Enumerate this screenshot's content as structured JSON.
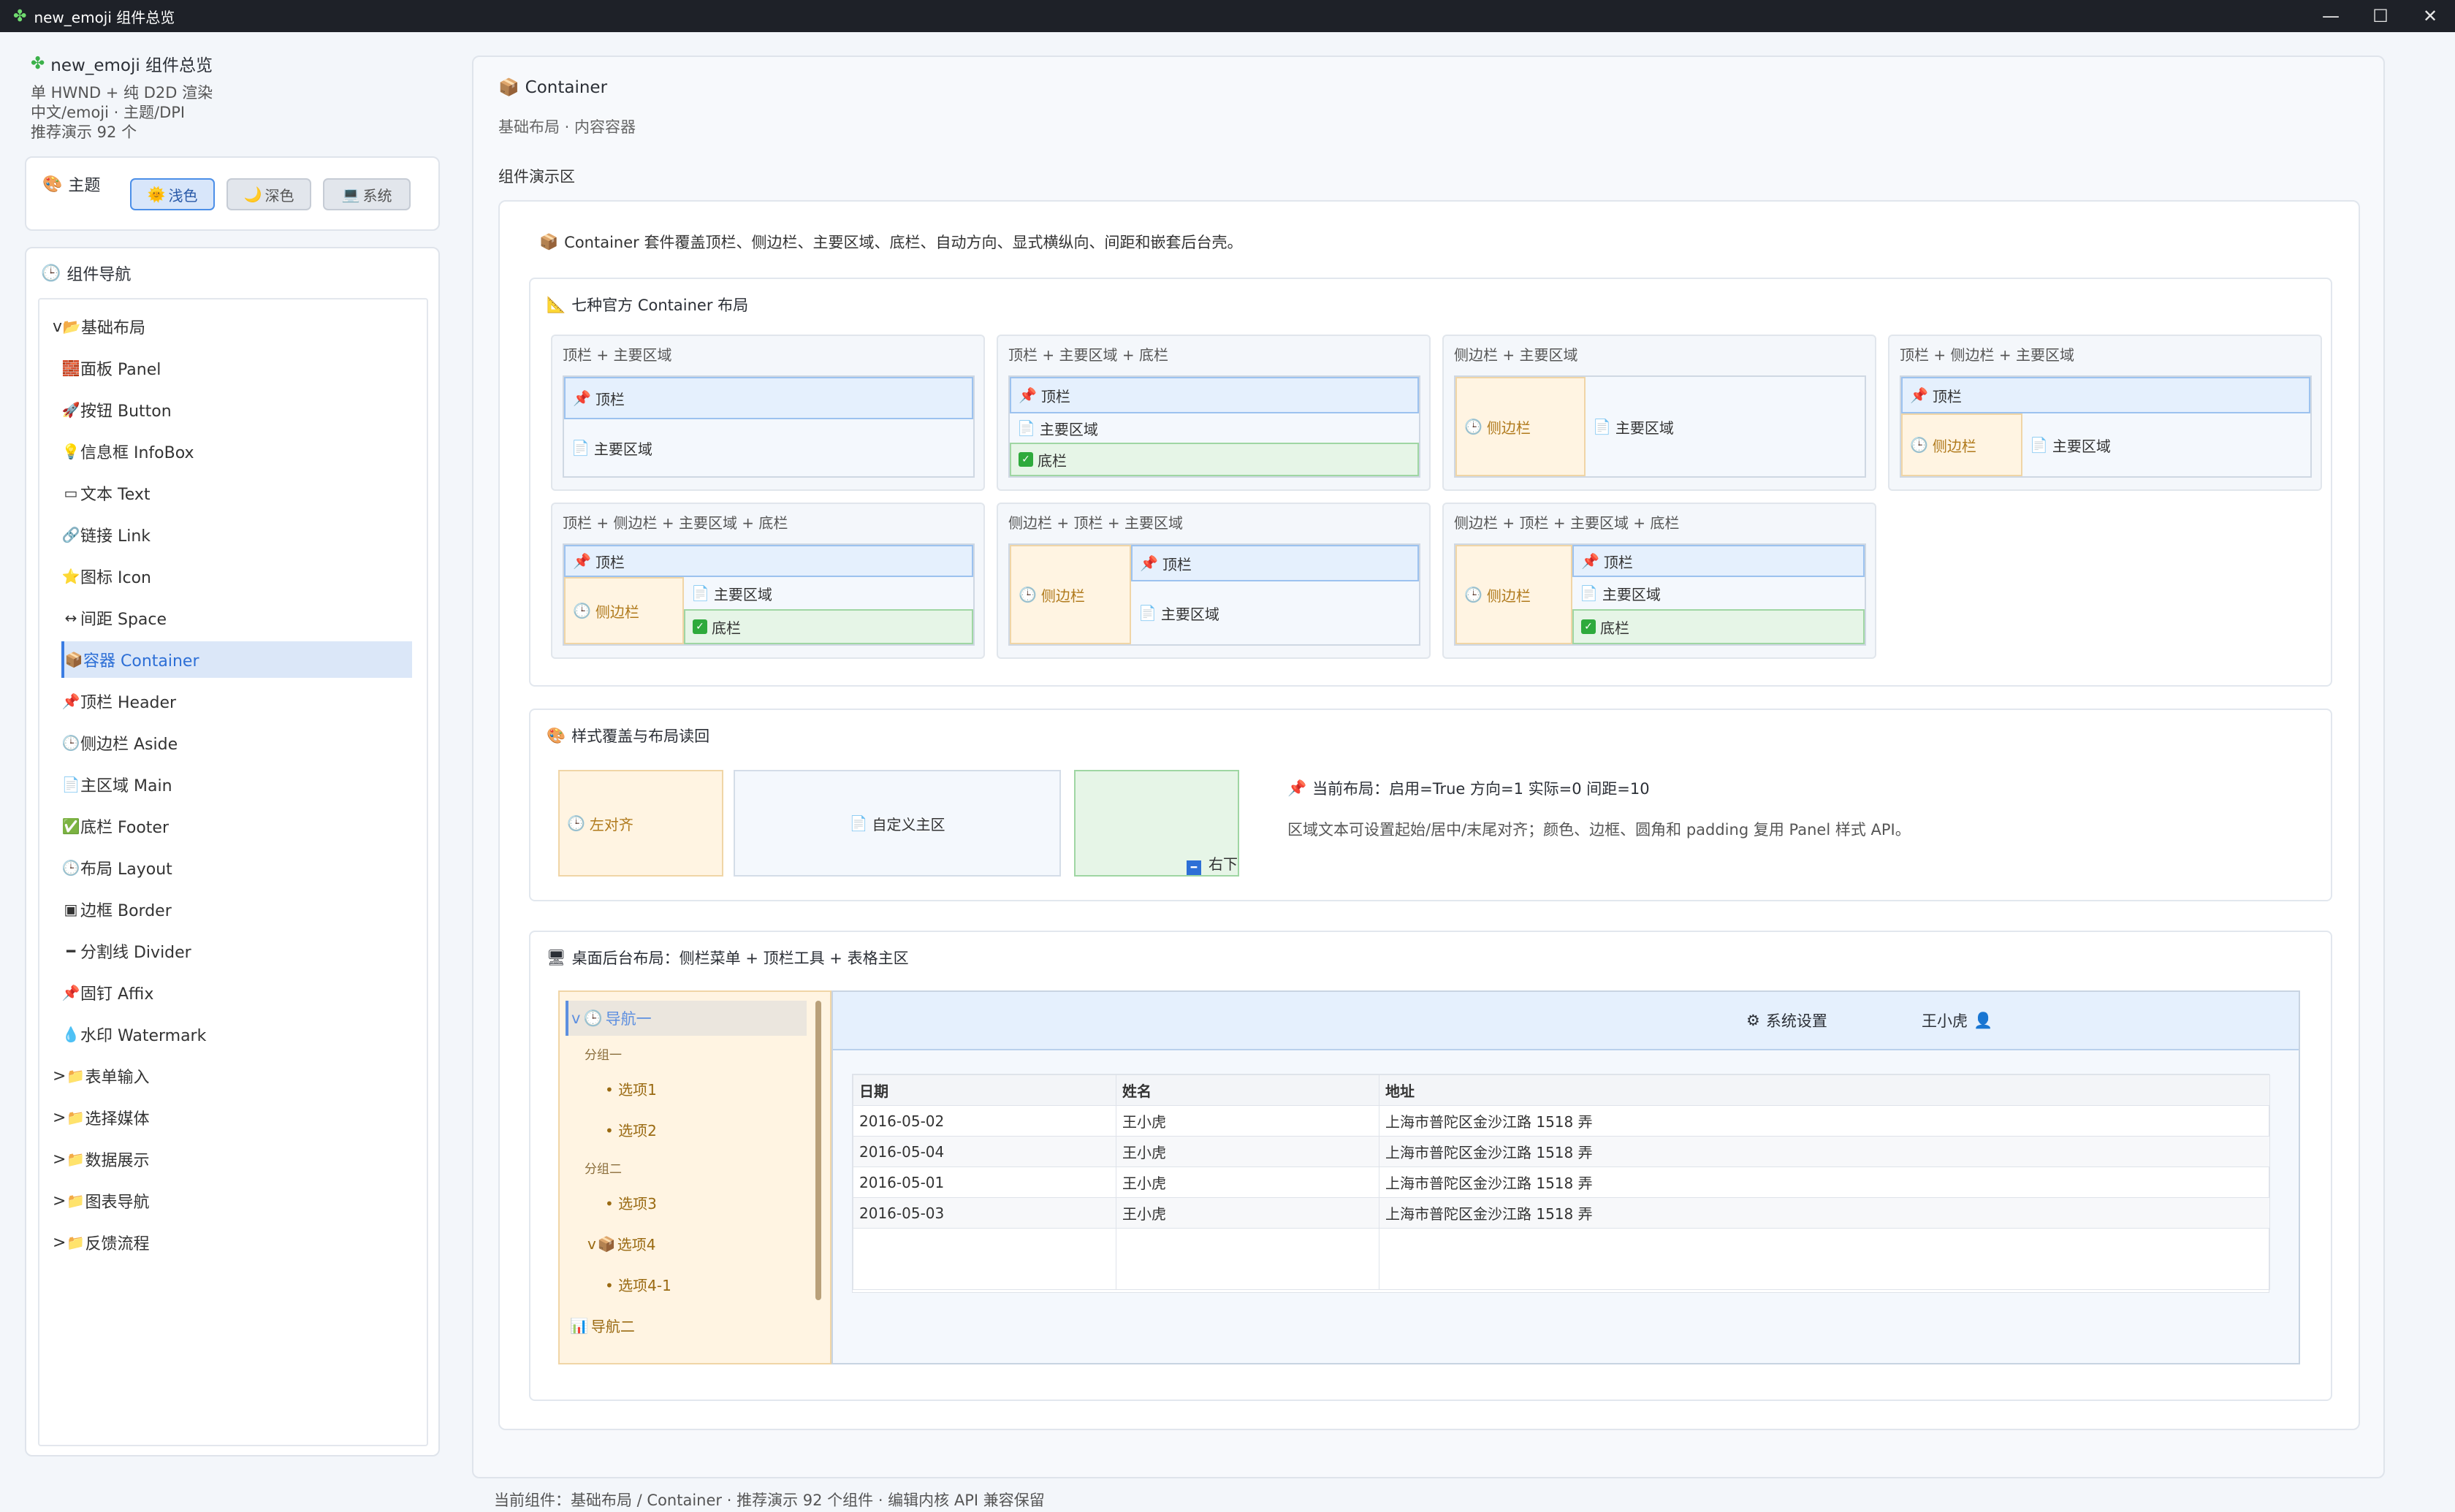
{
  "window": {
    "title": "new_emoji 组件总览",
    "minimize": "—",
    "maximize": "☐",
    "close": "✕"
  },
  "sidebar": {
    "app_name": "new_emoji 组件总览",
    "sub1": "单 HWND + 纯 D2D 渲染",
    "sub2": "中文/emoji · 主题/DPI",
    "sub3": "推荐演示 92 个",
    "theme_label": "主题",
    "theme_buttons": [
      "浅色",
      "深色",
      "系统"
    ],
    "nav_label": "组件导航",
    "nav": [
      {
        "label": "基础布局",
        "prefix": "v",
        "icon": "📂"
      },
      {
        "label": "面板 Panel",
        "icon": "🧱"
      },
      {
        "label": "按钮 Button",
        "icon": "🚀"
      },
      {
        "label": "信息框 InfoBox",
        "icon": "💡"
      },
      {
        "label": "文本 Text",
        "icon": "▭"
      },
      {
        "label": "链接 Link",
        "icon": "🔗"
      },
      {
        "label": "图标 Icon",
        "icon": "⭐"
      },
      {
        "label": "间距 Space",
        "icon": "↔"
      },
      {
        "label": "容器 Container",
        "icon": "📦"
      },
      {
        "label": "顶栏 Header",
        "icon": "📌"
      },
      {
        "label": "侧边栏 Aside",
        "icon": "🕒"
      },
      {
        "label": "主区域 Main",
        "icon": "📄"
      },
      {
        "label": "底栏 Footer",
        "icon": "✅"
      },
      {
        "label": "布局 Layout",
        "icon": "🕒"
      },
      {
        "label": "边框 Border",
        "icon": "▣"
      },
      {
        "label": "分割线 Divider",
        "icon": "━"
      },
      {
        "label": "固钉 Affix",
        "icon": "📌"
      },
      {
        "label": "水印 Watermark",
        "icon": "💧"
      },
      {
        "label": "表单输入",
        "prefix": ">",
        "icon": "📁"
      },
      {
        "label": "选择媒体",
        "prefix": ">",
        "icon": "📁"
      },
      {
        "label": "数据展示",
        "prefix": ">",
        "icon": "📁"
      },
      {
        "label": "图表导航",
        "prefix": ">",
        "icon": "📁"
      },
      {
        "label": "反馈流程",
        "prefix": ">",
        "icon": "📁"
      }
    ]
  },
  "main": {
    "title": "Container",
    "crumb": "基础布局 · 内容容器",
    "demo_label": "组件演示区",
    "intro": "Container 套件覆盖顶栏、侧边栏、主要区域、底栏、自动方向、显式横纵向、间距和嵌套后台壳。",
    "layouts_title": "七种官方 Container 布局",
    "regions": {
      "header": "顶栏",
      "main": "主要区域",
      "footer": "底栏",
      "aside": "侧边栏"
    },
    "layouts": [
      "顶栏 + 主要区域",
      "顶栏 + 主要区域 + 底栏",
      "侧边栏 + 主要区域",
      "顶栏 + 侧边栏 + 主要区域",
      "顶栏 + 侧边栏 + 主要区域 + 底栏",
      "侧边栏 + 顶栏 + 主要区域",
      "侧边栏 + 顶栏 + 主要区域 + 底栏"
    ],
    "style_title": "样式覆盖与布局读回",
    "style_left": "左对齐",
    "style_center": "自定义主区",
    "style_right": "右下",
    "style_status": "当前布局：启用=True 方向=1 实际=0 间距=10",
    "style_desc": "区域文本可设置起始/居中/末尾对齐；颜色、边框、圆角和 padding 复用 Panel 样式 API。",
    "admin_title": "桌面后台布局：侧栏菜单 + 顶栏工具 + 表格主区",
    "admin_menu": {
      "nav1": "导航一",
      "group1": "分组一",
      "opt1": "选项1",
      "opt2": "选项2",
      "group2": "分组二",
      "opt3": "选项3",
      "opt4": "选项4",
      "opt41": "选项4-1",
      "nav2": "导航二"
    },
    "admin_header": {
      "settings": "系统设置",
      "user": "王小虎"
    },
    "table": {
      "columns": [
        "日期",
        "姓名",
        "地址"
      ],
      "rows": [
        [
          "2016-05-02",
          "王小虎",
          "上海市普陀区金沙江路 1518 弄"
        ],
        [
          "2016-05-04",
          "王小虎",
          "上海市普陀区金沙江路 1518 弄"
        ],
        [
          "2016-05-01",
          "王小虎",
          "上海市普陀区金沙江路 1518 弄"
        ],
        [
          "2016-05-03",
          "王小虎",
          "上海市普陀区金沙江路 1518 弄"
        ]
      ]
    }
  },
  "footer": "当前组件：基础布局 / Container · 推荐演示 92 个组件 · 编辑内核 API 兼容保留"
}
